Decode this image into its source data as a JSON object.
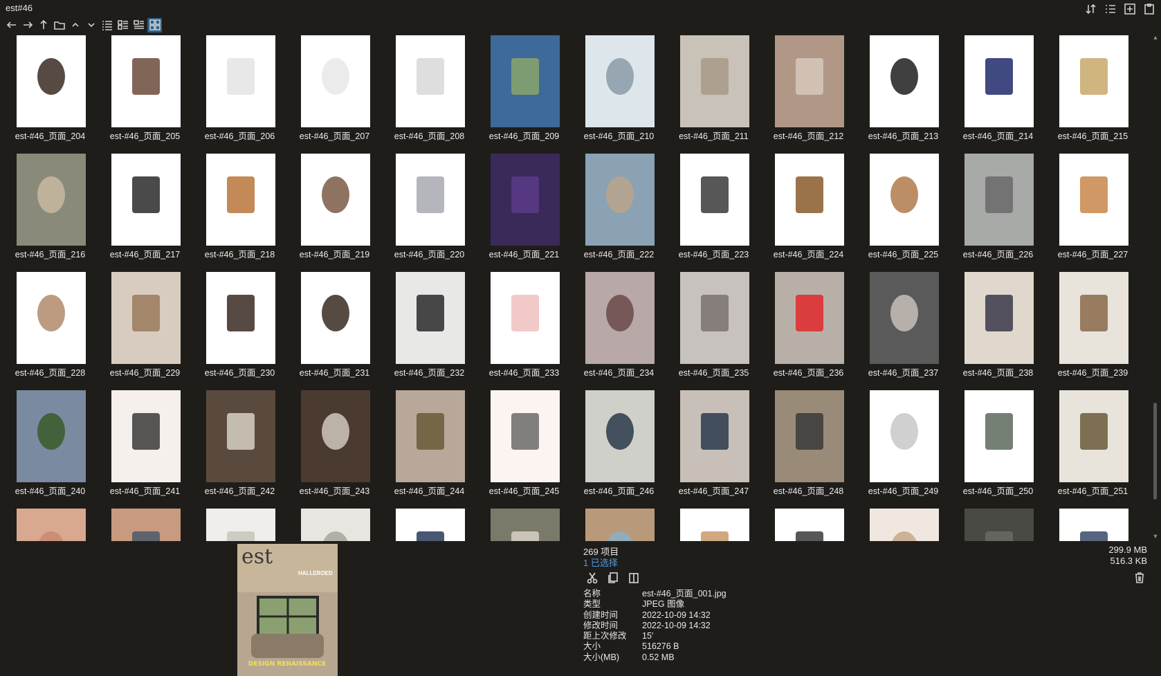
{
  "window": {
    "title": "est#46"
  },
  "thumbnails": [
    {
      "label": "est-#46_页面_204",
      "bg": "#ffffff",
      "fg": "#3a2a22"
    },
    {
      "label": "est-#46_页面_205",
      "bg": "#ffffff",
      "fg": "#6b4a3a"
    },
    {
      "label": "est-#46_页面_206",
      "bg": "#ffffff",
      "fg": "#e4e4e4"
    },
    {
      "label": "est-#46_页面_207",
      "bg": "#ffffff",
      "fg": "#e8e8e8"
    },
    {
      "label": "est-#46_页面_208",
      "bg": "#ffffff",
      "fg": "#d8d8d8"
    },
    {
      "label": "est-#46_页面_209",
      "bg": "#3d6a9a",
      "fg": "#8aa56a"
    },
    {
      "label": "est-#46_页面_210",
      "bg": "#dde6ea",
      "fg": "#8a9aa8"
    },
    {
      "label": "est-#46_页面_211",
      "bg": "#c9c2b8",
      "fg": "#a89a86"
    },
    {
      "label": "est-#46_页面_212",
      "bg": "#b09786",
      "fg": "#d6c8bc"
    },
    {
      "label": "est-#46_页面_213",
      "bg": "#ffffff",
      "fg": "#1e1e1e"
    },
    {
      "label": "est-#46_页面_214",
      "bg": "#ffffff",
      "fg": "#1e2a6a"
    },
    {
      "label": "est-#46_页面_215",
      "bg": "#ffffff",
      "fg": "#c9a86a"
    },
    {
      "label": "est-#46_页面_216",
      "bg": "#8a8a7a",
      "fg": "#c8b8a0"
    },
    {
      "label": "est-#46_页面_217",
      "bg": "#ffffff",
      "fg": "#2a2a2a"
    },
    {
      "label": "est-#46_页面_218",
      "bg": "#ffffff",
      "fg": "#b8763a"
    },
    {
      "label": "est-#46_页面_219",
      "bg": "#ffffff",
      "fg": "#7a5a48"
    },
    {
      "label": "est-#46_页面_220",
      "bg": "#ffffff",
      "fg": "#a8a8b0"
    },
    {
      "label": "est-#46_页面_221",
      "bg": "#3a2a5a",
      "fg": "#5a3a8a"
    },
    {
      "label": "est-#46_页面_222",
      "bg": "#8aa2b4",
      "fg": "#b8a48a"
    },
    {
      "label": "est-#46_页面_223",
      "bg": "#ffffff",
      "fg": "#3a3a3a"
    },
    {
      "label": "est-#46_页面_224",
      "bg": "#ffffff",
      "fg": "#8a5a2a"
    },
    {
      "label": "est-#46_页面_225",
      "bg": "#ffffff",
      "fg": "#b07a4a"
    },
    {
      "label": "est-#46_页面_226",
      "bg": "#a8aaa8",
      "fg": "#6a6a6a"
    },
    {
      "label": "est-#46_页面_227",
      "bg": "#ffffff",
      "fg": "#c8864a"
    },
    {
      "label": "est-#46_页面_228",
      "bg": "#ffffff",
      "fg": "#b08a6a"
    },
    {
      "label": "est-#46_页面_229",
      "bg": "#d8ccc0",
      "fg": "#9a7a5a"
    },
    {
      "label": "est-#46_页面_230",
      "bg": "#ffffff",
      "fg": "#3a2a22"
    },
    {
      "label": "est-#46_页面_231",
      "bg": "#ffffff",
      "fg": "#3a2a22"
    },
    {
      "label": "est-#46_页面_232",
      "bg": "#e8e8e6",
      "fg": "#2a2a2a"
    },
    {
      "label": "est-#46_页面_233",
      "bg": "#ffffff",
      "fg": "#f0c0c0"
    },
    {
      "label": "est-#46_页面_234",
      "bg": "#b8a8a8",
      "fg": "#6a4a4a"
    },
    {
      "label": "est-#46_页面_235",
      "bg": "#c8c2be",
      "fg": "#7a7270"
    },
    {
      "label": "est-#46_页面_236",
      "bg": "#b8b0a8",
      "fg": "#e0282a"
    },
    {
      "label": "est-#46_页面_237",
      "bg": "#5a5a5a",
      "fg": "#c8c0b8"
    },
    {
      "label": "est-#46_页面_238",
      "bg": "#e0d8cc",
      "fg": "#3a3a4a"
    },
    {
      "label": "est-#46_页面_239",
      "bg": "#e8e4dc",
      "fg": "#8a6a4a"
    },
    {
      "label": "est-#46_页面_240",
      "bg": "#7a8aa0",
      "fg": "#3a5a2a"
    },
    {
      "label": "est-#46_页面_241",
      "bg": "#f6f0ec",
      "fg": "#3a3a3a"
    },
    {
      "label": "est-#46_页面_242",
      "bg": "#5a4a3e",
      "fg": "#d8d0c4"
    },
    {
      "label": "est-#46_页面_243",
      "bg": "#4a3a30",
      "fg": "#d0c8bc"
    },
    {
      "label": "est-#46_页面_244",
      "bg": "#b8a89a",
      "fg": "#6a5a3a"
    },
    {
      "label": "est-#46_页面_245",
      "bg": "#fbf4f0",
      "fg": "#6a6a6a"
    },
    {
      "label": "est-#46_页面_246",
      "bg": "#d0d0ca",
      "fg": "#2a3a4a"
    },
    {
      "label": "est-#46_页面_247",
      "bg": "#c8c0b8",
      "fg": "#2a3a4a"
    },
    {
      "label": "est-#46_页面_248",
      "bg": "#9a8a78",
      "fg": "#3a3a3a"
    },
    {
      "label": "est-#46_页面_249",
      "bg": "#ffffff",
      "fg": "#c8c8c8"
    },
    {
      "label": "est-#46_页面_250",
      "bg": "#ffffff",
      "fg": "#5a6a5a"
    },
    {
      "label": "est-#46_页面_251",
      "bg": "#e8e4dc",
      "fg": "#6a5a3a"
    },
    {
      "label": "",
      "bg": "#d8a890",
      "fg": "#c88a70"
    },
    {
      "label": "",
      "bg": "#c89a80",
      "fg": "#4a5a6a"
    },
    {
      "label": "",
      "bg": "#f0eeea",
      "fg": "#c8c4bc"
    },
    {
      "label": "",
      "bg": "#e8e6e0",
      "fg": "#a8a49c"
    },
    {
      "label": "",
      "bg": "#ffffff",
      "fg": "#2a3a5a"
    },
    {
      "label": "",
      "bg": "#7a7a6a",
      "fg": "#d8d0c4"
    },
    {
      "label": "",
      "bg": "#b89a7a",
      "fg": "#8ab0c8"
    },
    {
      "label": "",
      "bg": "#ffffff",
      "fg": "#c89a6a"
    },
    {
      "label": "",
      "bg": "#ffffff",
      "fg": "#3a3a3a"
    },
    {
      "label": "",
      "bg": "#f0e8e0",
      "fg": "#c8a88a"
    },
    {
      "label": "",
      "bg": "#4a4a44",
      "fg": "#6a6a64"
    },
    {
      "label": "",
      "bg": "#ffffff",
      "fg": "#3a4a6a"
    }
  ],
  "preview": {
    "brand": "est",
    "cover_line": "HALLEROED",
    "cover_headline": "DESIGN RENAISSANCE"
  },
  "status": {
    "item_count": "269 项目",
    "selected": "1 已选择",
    "total_size": "299.9 MB",
    "selected_size": "516.3 KB"
  },
  "properties": [
    {
      "key": "名称",
      "value": "est-#46_页面_001.jpg"
    },
    {
      "key": "类型",
      "value": "JPEG 图像"
    },
    {
      "key": "创建时间",
      "value": "2022-10-09  14:32"
    },
    {
      "key": "修改时间",
      "value": "2022-10-09  14:32"
    },
    {
      "key": "距上次修改",
      "value": "15'"
    },
    {
      "key": "大小",
      "value": "516276 B"
    },
    {
      "key": "大小(MB)",
      "value": "0.52 MB"
    }
  ]
}
